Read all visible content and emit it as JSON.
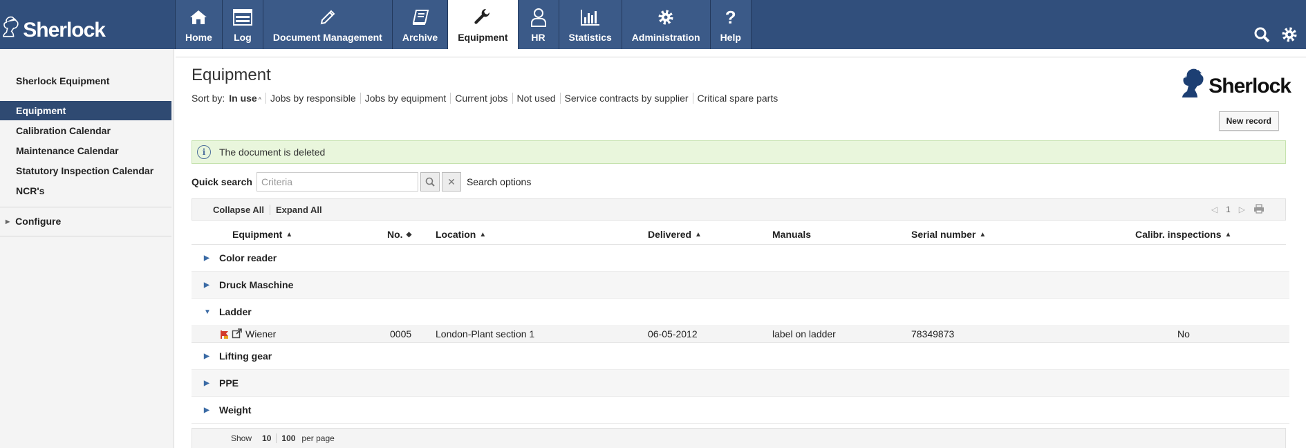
{
  "app": {
    "logo_text": "Sherlock"
  },
  "nav": {
    "items": [
      {
        "label": "Home",
        "icon": "home-icon"
      },
      {
        "label": "Log",
        "icon": "log-icon"
      },
      {
        "label": "Document Management",
        "icon": "pencil-icon"
      },
      {
        "label": "Archive",
        "icon": "book-icon"
      },
      {
        "label": "Equipment",
        "icon": "wrench-icon",
        "active": true
      },
      {
        "label": "HR",
        "icon": "person-icon"
      },
      {
        "label": "Statistics",
        "icon": "bar-chart-icon"
      },
      {
        "label": "Administration",
        "icon": "gear-icon"
      },
      {
        "label": "Help",
        "icon": "question-icon"
      }
    ]
  },
  "top_tools": {
    "search_icon": "search-icon",
    "settings_icon": "gear-icon"
  },
  "sidebar": {
    "title": "Sherlock Equipment",
    "items": [
      {
        "label": "Equipment",
        "active": true
      },
      {
        "label": "Calibration Calendar"
      },
      {
        "label": "Maintenance Calendar"
      },
      {
        "label": "Statutory Inspection Calendar"
      },
      {
        "label": "NCR's"
      }
    ],
    "configure": "Configure"
  },
  "main": {
    "title": "Equipment",
    "sort_label": "Sort by:",
    "sort_current": "In use",
    "sort_links": [
      "Jobs by responsible",
      "Jobs by equipment",
      "Current jobs",
      "Not used",
      "Service contracts by supplier",
      "Critical spare parts"
    ],
    "logo_text": "Sherlock",
    "new_record": "New record",
    "notice": "The document is deleted",
    "quick_search_label": "Quick search",
    "quick_search_placeholder": "Criteria",
    "search_options": "Search options",
    "collapse_all": "Collapse All",
    "expand_all": "Expand All",
    "page_number": "1",
    "columns": [
      "Equipment",
      "No.",
      "Location",
      "Delivered",
      "Manuals",
      "Serial number",
      "Calibr. inspections"
    ],
    "groups": [
      "Color reader",
      "Druck Maschine",
      "Ladder",
      "Lifting gear",
      "PPE",
      "Weight"
    ],
    "row": {
      "equipment": "Wiener",
      "no": "0005",
      "location": "London-Plant section 1",
      "delivered": "06-05-2012",
      "manuals": "label on ladder",
      "serial": "78349873",
      "calibr": "No"
    },
    "footer": {
      "show": "Show",
      "opt1": "10",
      "opt2": "100",
      "per_page": "per page"
    }
  },
  "colors": {
    "topbar": "#314f7c",
    "sidebar_active": "#2f4a72",
    "notice_bg": "#e9f6dc",
    "flag": "#d23b2c"
  }
}
